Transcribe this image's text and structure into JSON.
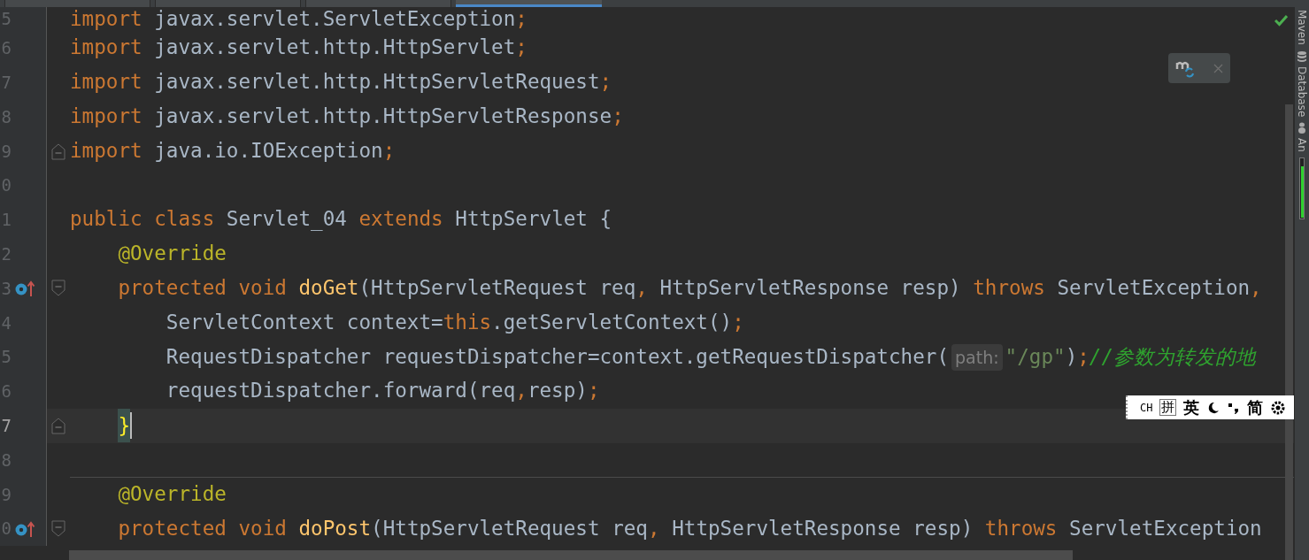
{
  "tabs": [
    {
      "selected": false
    },
    {
      "selected": false
    },
    {
      "selected": false
    },
    {
      "selected": true
    }
  ],
  "lines": [
    {
      "number": "5",
      "current": false,
      "tokens": [
        {
          "kind": "kw",
          "text": "import "
        },
        {
          "kind": "plain",
          "text": "javax.servlet.ServletException"
        },
        {
          "kind": "kw",
          "text": ";"
        }
      ]
    },
    {
      "number": "6",
      "current": false,
      "tokens": [
        {
          "kind": "kw",
          "text": "import "
        },
        {
          "kind": "plain",
          "text": "javax.servlet.http.HttpServlet"
        },
        {
          "kind": "kw",
          "text": ";"
        }
      ]
    },
    {
      "number": "7",
      "current": false,
      "tokens": [
        {
          "kind": "kw",
          "text": "import "
        },
        {
          "kind": "plain",
          "text": "javax.servlet.http.HttpServletRequest"
        },
        {
          "kind": "kw",
          "text": ";"
        }
      ]
    },
    {
      "number": "8",
      "current": false,
      "tokens": [
        {
          "kind": "kw",
          "text": "import "
        },
        {
          "kind": "plain",
          "text": "javax.servlet.http.HttpServletResponse"
        },
        {
          "kind": "kw",
          "text": ";"
        }
      ]
    },
    {
      "number": "9",
      "current": false,
      "fold_marker": {
        "kind": "end"
      },
      "tokens": [
        {
          "kind": "kw",
          "text": "import "
        },
        {
          "kind": "plain",
          "text": "java.io.IOException"
        },
        {
          "kind": "kw",
          "text": ";"
        }
      ]
    },
    {
      "number": "0",
      "current": false
    },
    {
      "number": "1",
      "current": false,
      "tokens": [
        {
          "kind": "kw",
          "text": "public class "
        },
        {
          "kind": "plain",
          "text": "Servlet_04 "
        },
        {
          "kind": "kw",
          "text": "extends "
        },
        {
          "kind": "plain",
          "text": "HttpServlet {"
        }
      ]
    },
    {
      "number": "2",
      "current": false,
      "tokens": [
        {
          "kind": "ann",
          "text": "    @Override"
        }
      ]
    },
    {
      "number": "3",
      "current": false,
      "gutter_icon": {
        "kind": "override"
      },
      "fold_marker": {
        "kind": "start"
      },
      "tokens": [
        {
          "kind": "kw",
          "text": "    protected void "
        },
        {
          "kind": "fn",
          "text": "doGet"
        },
        {
          "kind": "plain",
          "text": "(HttpServletRequest req"
        },
        {
          "kind": "kw",
          "text": ", "
        },
        {
          "kind": "plain",
          "text": "HttpServletResponse resp) "
        },
        {
          "kind": "kw",
          "text": "throws "
        },
        {
          "kind": "plain",
          "text": "ServletException"
        },
        {
          "kind": "kw",
          "text": ","
        }
      ]
    },
    {
      "number": "4",
      "current": false,
      "tokens": [
        {
          "kind": "plain",
          "text": "        ServletContext context="
        },
        {
          "kind": "kw",
          "text": "this"
        },
        {
          "kind": "plain",
          "text": ".getServletContext()"
        },
        {
          "kind": "kw",
          "text": ";"
        }
      ]
    },
    {
      "number": "5",
      "current": false,
      "tokens": [
        {
          "kind": "plain",
          "text": "        RequestDispatcher requestDispatcher=context.getRequestDispatcher("
        },
        {
          "kind": "hint",
          "text": "path:"
        },
        {
          "kind": "str",
          "text": "\"/gp\""
        },
        {
          "kind": "plain",
          "text": ")"
        },
        {
          "kind": "kw",
          "text": ";"
        },
        {
          "kind": "comment",
          "text": "//参数为转发的地"
        }
      ]
    },
    {
      "number": "6",
      "current": false,
      "tokens": [
        {
          "kind": "plain",
          "text": "        requestDispatcher.forward(req"
        },
        {
          "kind": "kw",
          "text": ","
        },
        {
          "kind": "plain",
          "text": "resp)"
        },
        {
          "kind": "kw",
          "text": ";"
        }
      ]
    },
    {
      "number": "7",
      "current": true,
      "kind": "block_end",
      "fold_marker": {
        "kind": "end"
      },
      "tokens": [
        {
          "kind": "brace",
          "text": "}"
        }
      ]
    },
    {
      "number": "8",
      "current": false
    },
    {
      "number": "9",
      "current": false,
      "separator_before": true,
      "tokens": [
        {
          "kind": "ann",
          "text": "    @Override"
        }
      ]
    },
    {
      "number": "0",
      "current": false,
      "gutter_icon": {
        "kind": "override"
      },
      "fold_marker": {
        "kind": "start"
      },
      "tokens": [
        {
          "kind": "kw",
          "text": "    protected void "
        },
        {
          "kind": "fn",
          "text": "doPost"
        },
        {
          "kind": "plain",
          "text": "(HttpServletRequest req"
        },
        {
          "kind": "kw",
          "text": ", "
        },
        {
          "kind": "plain",
          "text": "HttpServletResponse resp) "
        },
        {
          "kind": "kw",
          "text": "throws "
        },
        {
          "kind": "plain",
          "text": "ServletException"
        }
      ]
    }
  ],
  "tool_windows": [
    {
      "label": "Maven"
    },
    {
      "label": "Database"
    },
    {
      "label": "An"
    }
  ],
  "ime_bar": [
    {
      "kind": "text",
      "text": "CH"
    },
    {
      "kind": "boxed",
      "text": "拼"
    },
    {
      "kind": "bold",
      "text": "英"
    },
    {
      "kind": "moon"
    },
    {
      "kind": "punct"
    },
    {
      "kind": "bold",
      "text": "简"
    },
    {
      "kind": "gear"
    }
  ]
}
